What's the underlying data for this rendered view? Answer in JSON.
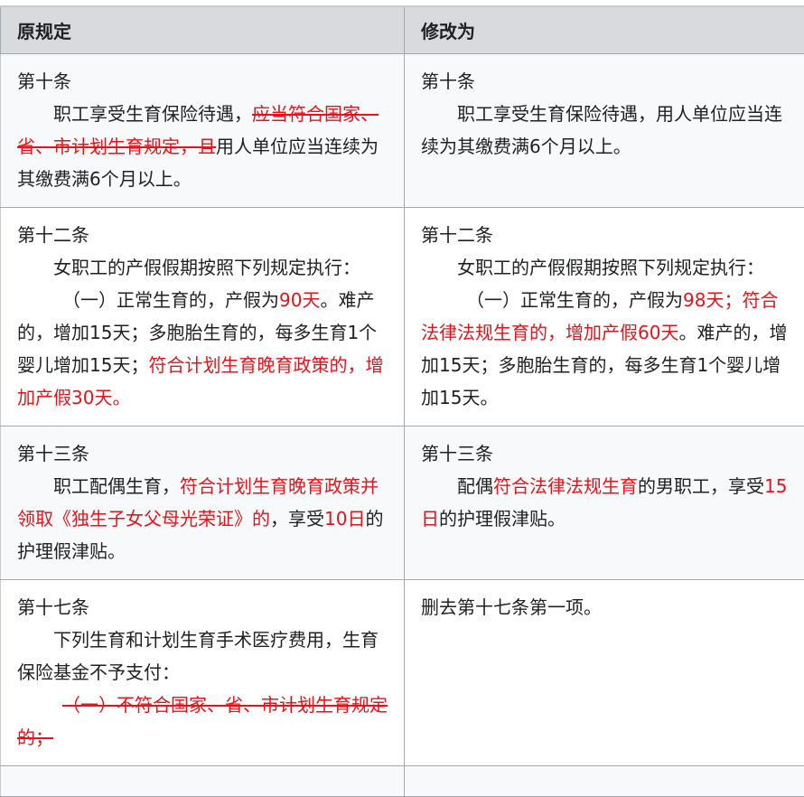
{
  "header": {
    "col_original": "原规定",
    "col_revised": "修改为"
  },
  "rows": [
    {
      "original": {
        "article": "第十条",
        "p1_a": "职工享受生育保险待遇，",
        "p1_del": "应当符合国家、省、市计划生育规定，且",
        "p1_b": "用人单位应当连续为其缴费满6个月以上。"
      },
      "revised": {
        "article": "第十条",
        "p1": "职工享受生育保险待遇，用人单位应当连续为其缴费满6个月以上。"
      }
    },
    {
      "original": {
        "article": "第十二条",
        "p1": "女职工的产假假期按照下列规定执行：",
        "p2_a": "（一）正常生育的，产假为",
        "p2_red1": "90天",
        "p2_b": "。难产的，增加15天；多胞胎生育的，每多生育1个婴儿增加15天；",
        "p2_red2": "符合计划生育晚育政策的，增加产假30天。"
      },
      "revised": {
        "article": "第十二条",
        "p1": "女职工的产假假期按照下列规定执行：",
        "p2_a": "（一）正常生育的，产假为",
        "p2_red1": "98天",
        "p2_b": "；",
        "p2_red2": "符合法律法规生育的，增加产假60天",
        "p2_c": "。难产的，增加15天；多胞胎生育的，每多生育1个婴儿增加15天。"
      }
    },
    {
      "original": {
        "article": "第十三条",
        "p1_a": "职工配偶生育，",
        "p1_red1": "符合计划生育晚育政策并领取《独生子女父母光荣证》的",
        "p1_b": "，享受",
        "p1_red2": "10日",
        "p1_c": "的护理假津贴。"
      },
      "revised": {
        "article": "第十三条",
        "p1_a": "配偶",
        "p1_red1": "符合法律法规生育",
        "p1_b": "的男职工，享受",
        "p1_red2": "15日",
        "p1_c": "的护理假津贴。"
      }
    },
    {
      "original": {
        "article": "第十七条",
        "p1": "下列生育和计划生育手术医疗费用，生育保险基金不予支付：",
        "p2_del": "（一）不符合国家、省、市计划生育规定的；"
      },
      "revised": {
        "p1": "删去第十七条第一项。"
      }
    }
  ],
  "colors": {
    "highlight": "#e8131a",
    "header_bg": "#d8dadd",
    "row_alt_bg": "#f8f9fa"
  }
}
